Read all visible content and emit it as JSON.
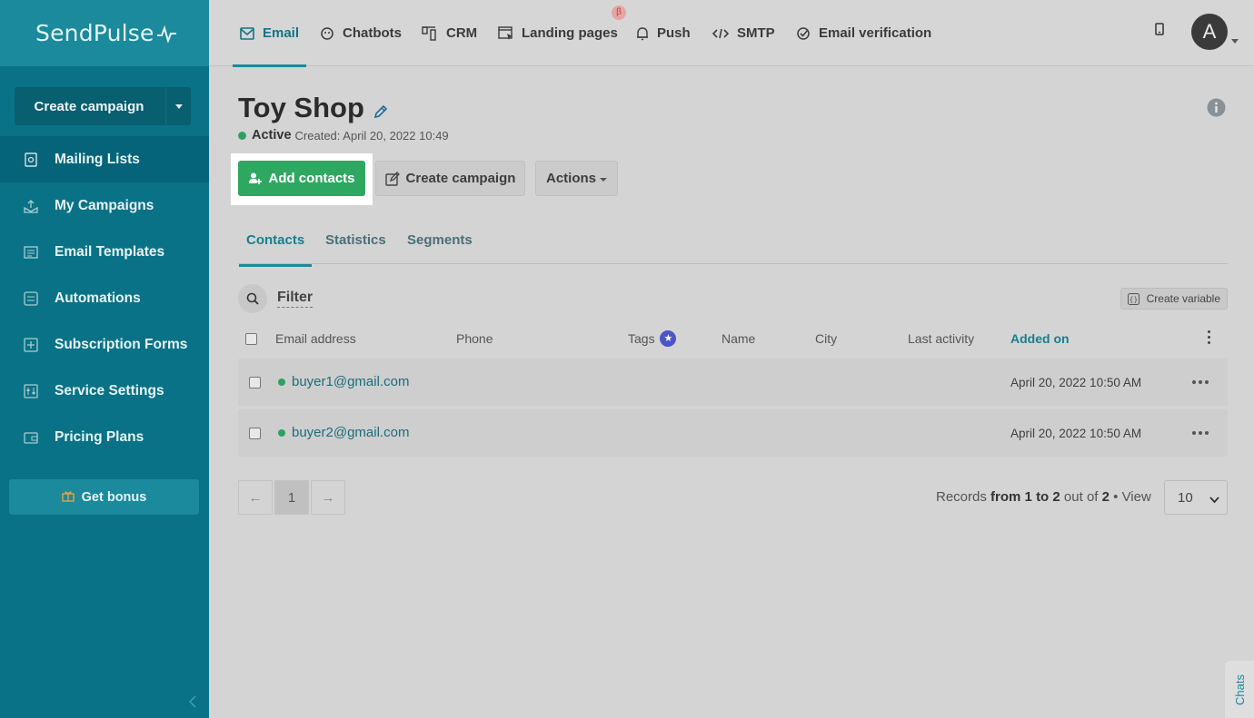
{
  "brand": {
    "logo_text": "SendPulse"
  },
  "sidebar": {
    "create_campaign": "Create campaign",
    "items": [
      {
        "label": "Mailing Lists",
        "icon": "mailing-lists-icon"
      },
      {
        "label": "My Campaigns",
        "icon": "campaigns-icon"
      },
      {
        "label": "Email Templates",
        "icon": "templates-icon"
      },
      {
        "label": "Automations",
        "icon": "automations-icon"
      },
      {
        "label": "Subscription Forms",
        "icon": "forms-icon"
      },
      {
        "label": "Service Settings",
        "icon": "settings-icon"
      },
      {
        "label": "Pricing Plans",
        "icon": "wallet-icon"
      }
    ],
    "bonus": "Get bonus"
  },
  "topnav": {
    "tabs": [
      {
        "label": "Email"
      },
      {
        "label": "Chatbots"
      },
      {
        "label": "CRM"
      },
      {
        "label": "Landing pages"
      },
      {
        "label": "Push"
      },
      {
        "label": "SMTP"
      },
      {
        "label": "Email verification"
      }
    ],
    "beta": "β",
    "avatar": "A"
  },
  "page": {
    "title": "Toy Shop",
    "status": "Active",
    "created": "Created: April 20, 2022 10:49",
    "add_contacts": "Add contacts",
    "create_campaign": "Create campaign",
    "actions": "Actions"
  },
  "subtabs": [
    "Contacts",
    "Statistics",
    "Segments"
  ],
  "filter": {
    "label": "Filter",
    "create_variable": "Create variable"
  },
  "table": {
    "columns": [
      "Email address",
      "Phone",
      "Tags",
      "Name",
      "City",
      "Last activity",
      "Added on"
    ],
    "rows": [
      {
        "email": "buyer1@gmail.com",
        "added": "April 20, 2022 10:50 AM"
      },
      {
        "email": "buyer2@gmail.com",
        "added": "April 20, 2022 10:50 AM"
      }
    ]
  },
  "pagination": {
    "prev": "←",
    "page": "1",
    "next": "→",
    "records_prefix": "Records",
    "records_from": "from",
    "records_start": "1",
    "records_to": "to",
    "records_end": "2",
    "records_outof": "out of",
    "records_total": "2",
    "view_label": "View",
    "view_value": "10"
  },
  "chats": "Chats",
  "colors": {
    "sidebar": "#0a7286",
    "accent": "#1a8a9c",
    "primary_button": "#2ea861"
  }
}
